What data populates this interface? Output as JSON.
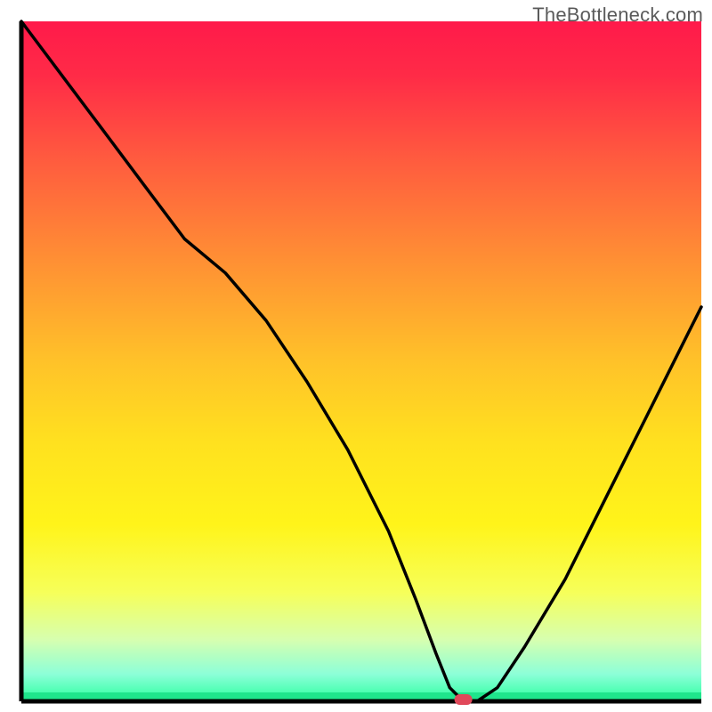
{
  "watermark": "TheBottleneck.com",
  "chart_data": {
    "type": "line",
    "title": "",
    "xlabel": "",
    "ylabel": "",
    "xlim": [
      0,
      100
    ],
    "ylim": [
      0,
      100
    ],
    "grid": false,
    "legend": false,
    "description": "Bottleneck curve on a vertical red-to-green gradient background. Black curve starts top-left, descends to a minimum near x≈65, then rises toward the right. A small red marker sits at the minimum on the green baseline.",
    "background_gradient_stops": [
      {
        "offset": 0.0,
        "color": "#ff1a4a"
      },
      {
        "offset": 0.08,
        "color": "#ff2b47"
      },
      {
        "offset": 0.2,
        "color": "#ff5a3f"
      },
      {
        "offset": 0.35,
        "color": "#ff8f34"
      },
      {
        "offset": 0.5,
        "color": "#ffc229"
      },
      {
        "offset": 0.62,
        "color": "#ffe11f"
      },
      {
        "offset": 0.74,
        "color": "#fff41a"
      },
      {
        "offset": 0.84,
        "color": "#f6ff5a"
      },
      {
        "offset": 0.91,
        "color": "#d6ffb0"
      },
      {
        "offset": 0.96,
        "color": "#8cffd8"
      },
      {
        "offset": 1.0,
        "color": "#2cff9f"
      }
    ],
    "series": [
      {
        "name": "bottleneck-curve",
        "color": "#000000",
        "x": [
          0,
          6,
          12,
          18,
          24,
          30,
          36,
          42,
          48,
          54,
          58,
          61,
          63,
          65,
          67,
          70,
          74,
          80,
          86,
          92,
          98,
          100
        ],
        "y": [
          100,
          92,
          84,
          76,
          68,
          63,
          56,
          47,
          37,
          25,
          15,
          7,
          2,
          0,
          0,
          2,
          8,
          18,
          30,
          42,
          54,
          58
        ]
      }
    ],
    "marker": {
      "x": 65,
      "y": 0,
      "color": "#e0485a",
      "rx": 10,
      "ry": 6
    },
    "axes": {
      "left": {
        "x": 3.0,
        "y1": 3.0,
        "y2": 98.5
      },
      "bottom": {
        "y": 98.5,
        "x1": 3.0,
        "x2": 98.5
      }
    }
  }
}
